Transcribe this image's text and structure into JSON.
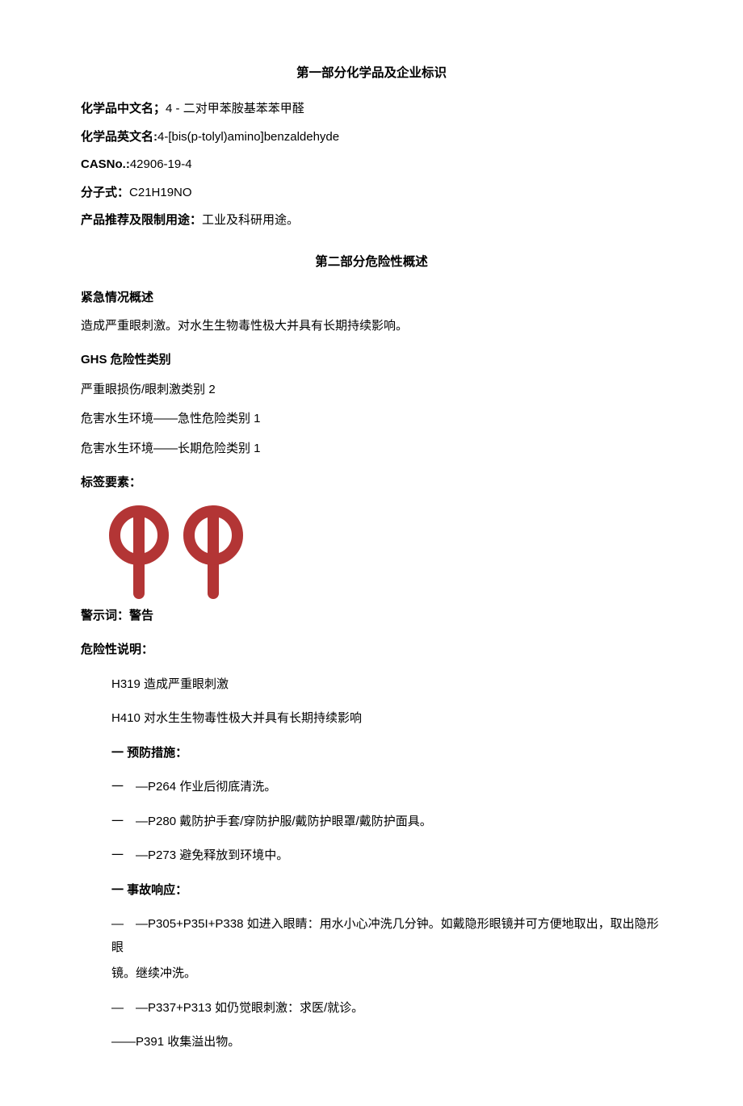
{
  "section1": {
    "title": "第一部分化学品及企业标识",
    "name_cn_label": "化学品中文名；",
    "name_cn_value": "4 - 二对甲苯胺基苯苯甲醛",
    "name_en_label": "化学品英文名:",
    "name_en_value": "4-[bis(p-tolyl)amino]benzaldehyde",
    "cas_label": "CASNo.:",
    "cas_value": "42906-19-4",
    "formula_label": "分子式：",
    "formula_value": "C21H19NO",
    "use_label": "产品推荐及限制用途：",
    "use_value": "工业及科研用途。"
  },
  "section2": {
    "title": "第二部分危险性概述",
    "emergency_label": "紧急情况概述",
    "emergency_text": "造成严重眼刺激。对水生生物毒性极大并具有长期持续影响。",
    "ghs_label": "GHS 危险性类别",
    "ghs_cat1": "严重眼损伤/眼刺激类别 2",
    "ghs_cat2": "危害水生环境——急性危险类别 1",
    "ghs_cat3": "危害水生环境——长期危险类别 1",
    "label_elements": "标签要素：",
    "signal_label": "警示词：",
    "signal_value": "警告",
    "hazard_statements_label": "危险性说明：",
    "h319": "H319 造成严重眼刺激",
    "h410": "H410 对水生生物毒性极大并具有长期持续影响",
    "prevent_label": "一 预防措施：",
    "p264": "一　—P264 作业后彻底清洗。",
    "p280": "一　—P280 戴防护手套/穿防护服/戴防护眼罩/戴防护面具。",
    "p273": "一　—P273 避免释放到环境中。",
    "response_label": "一 事故响应：",
    "p305_a": "—　—P305+P35I+P338 如进入眼睛：用水小心冲洗几分钟。如戴隐形眼镜并可方便地取出，取出隐形眼",
    "p305_b": "镜。继续冲洗。",
    "p337": "—　—P337+P313 如仍觉眼刺激：求医/就诊。",
    "p391": "——P391 收集溢出物。"
  }
}
